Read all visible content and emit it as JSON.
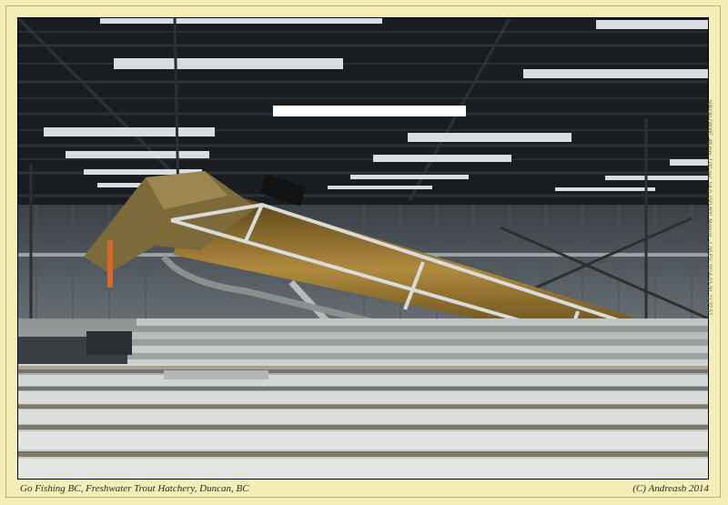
{
  "photo": {
    "alt": "Go Fishing BC, Freshwater Trout Hatchery, Duncan, BC",
    "colors": {
      "frame": "#f4efb8",
      "roof": "#1c1f22",
      "lights": "#e9eef2",
      "conveyor": "#8a6a2c",
      "troughs": "#c9ccca"
    }
  },
  "caption": {
    "left": "Go Fishing BC, Freshwater Trout Hatchery, Duncan, BC",
    "right": "(C) Andreasb 2014"
  },
  "exif": "NIKON D800E, 48 mm, 1/30 sec, f/4.0, ISO 800, Manual, -1.00 EV, 2014-03-30, 11:37:57"
}
